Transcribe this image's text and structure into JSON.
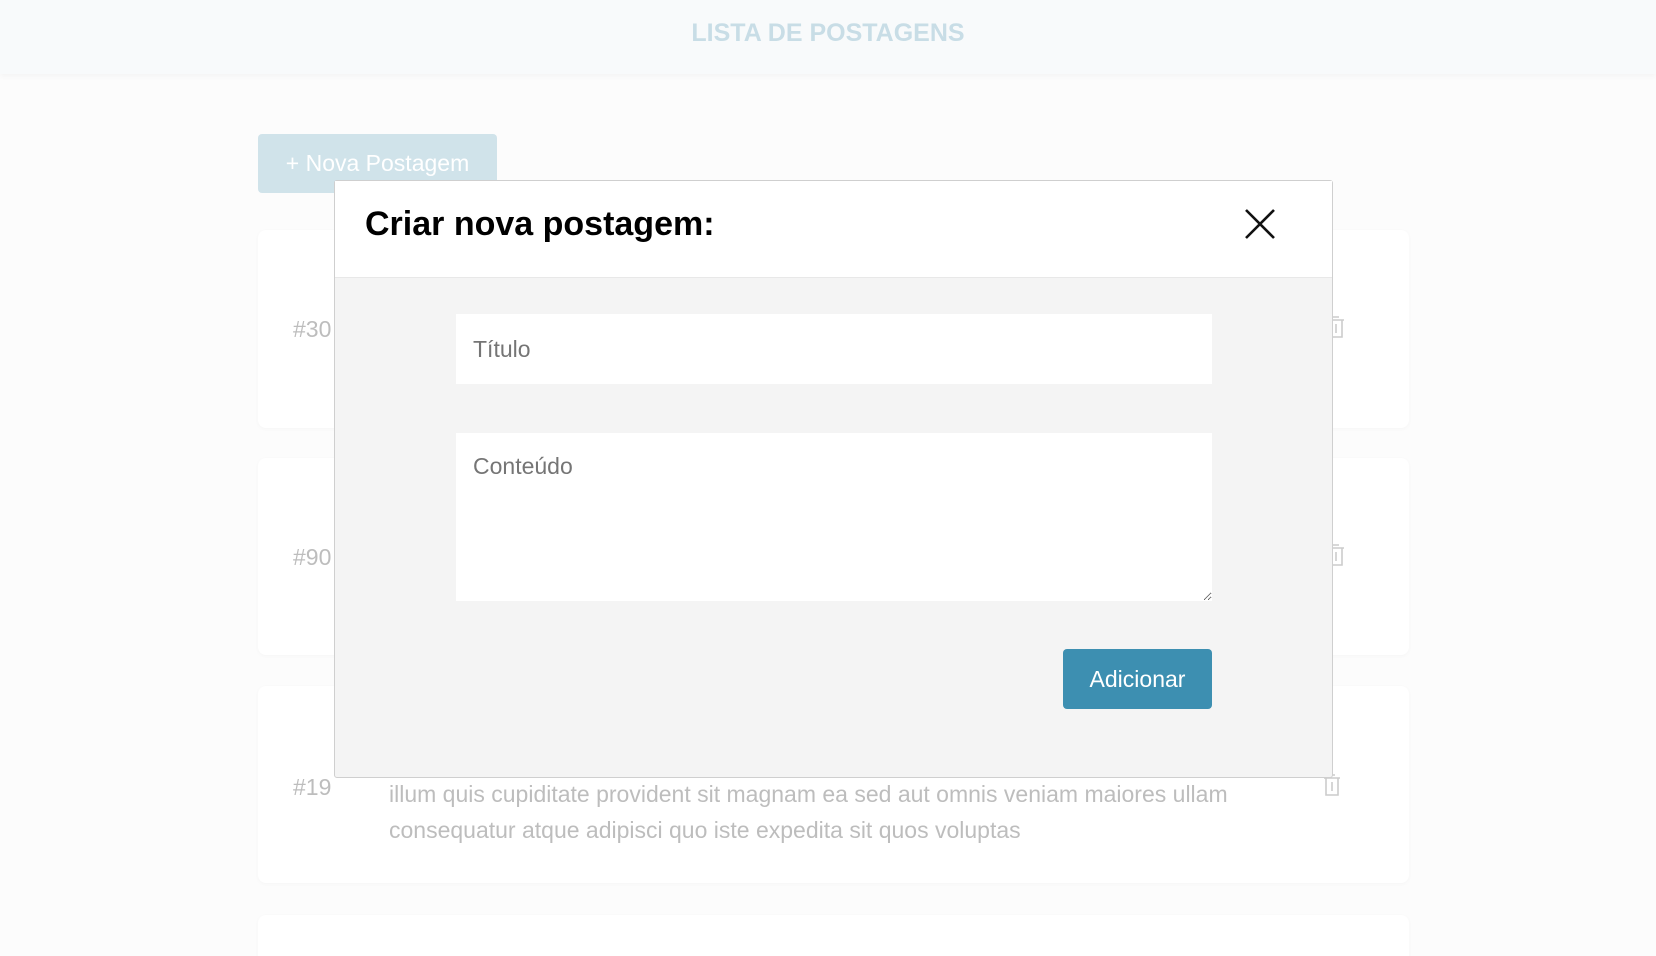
{
  "header": {
    "title": "LISTA DE POSTAGENS"
  },
  "toolbar": {
    "new_post_label": "+ Nova Postagem"
  },
  "posts": [
    {
      "id": "#30"
    },
    {
      "id": "#90"
    },
    {
      "id": "#19",
      "text_lines": [
        "illum quis cupiditate provident sit magnam ea sed aut omnis veniam maiores ullam",
        "consequatur atque adipisci quo iste expedita sit quos voluptas"
      ]
    }
  ],
  "modal": {
    "title": "Criar nova postagem:",
    "title_placeholder": "Título",
    "content_placeholder": "Conteúdo",
    "submit_label": "Adicionar"
  },
  "colors": {
    "accent": "#3d8fb1",
    "faded_accent": "#d0e3ea"
  }
}
